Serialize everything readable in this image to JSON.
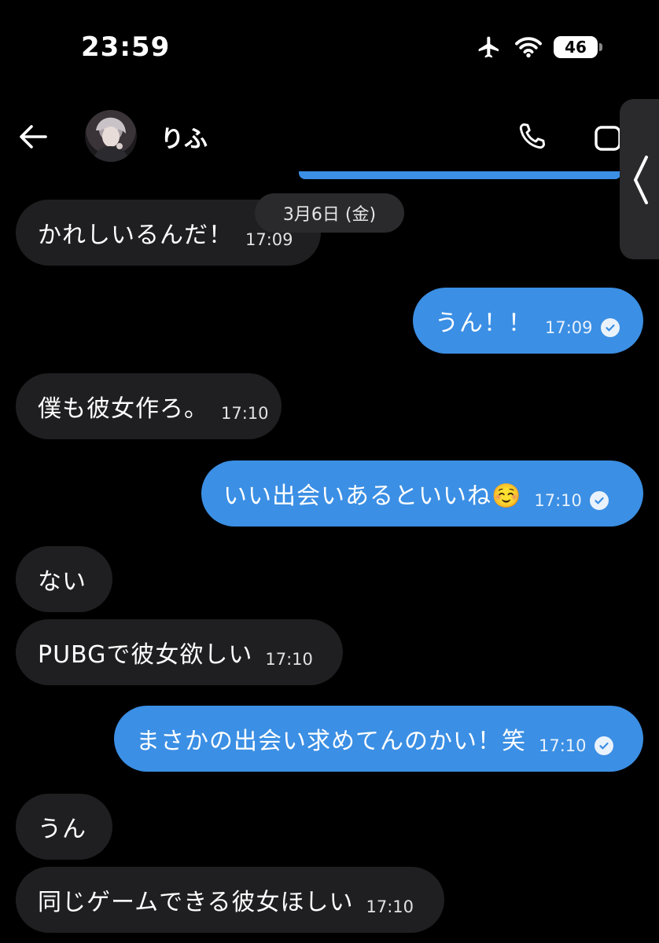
{
  "status": {
    "time": "23:59",
    "battery": "46"
  },
  "header": {
    "contact_name": "りふ"
  },
  "date_separator": "3月6日 (金)",
  "messages": [
    {
      "dir": "in",
      "text": "かれしいるんだ！",
      "time": "17:09"
    },
    {
      "dir": "out",
      "text": "うん！！",
      "time": "17:09"
    },
    {
      "dir": "in",
      "text": "僕も彼女作ろ。",
      "time": "17:10"
    },
    {
      "dir": "out",
      "text": "いい出会いあるといいね☺️",
      "time": "17:10"
    },
    {
      "dir": "in",
      "text": "ない",
      "time": ""
    },
    {
      "dir": "in",
      "text": "PUBGで彼女欲しい",
      "time": "17:10"
    },
    {
      "dir": "out",
      "text": "まさかの出会い求めてんのかい！笑",
      "time": "17:10"
    },
    {
      "dir": "in",
      "text": "うん",
      "time": ""
    },
    {
      "dir": "in",
      "text": "同じゲームできる彼女ほしい",
      "time": "17:10"
    }
  ],
  "colors": {
    "outgoing": "#3b8fe4",
    "incoming": "#1f1f21",
    "background": "#000000"
  },
  "icons": [
    "back-arrow-icon",
    "phone-icon",
    "video-icon",
    "airplane-icon",
    "wifi-icon",
    "battery-icon",
    "chevron-left-icon",
    "read-check-icon"
  ]
}
